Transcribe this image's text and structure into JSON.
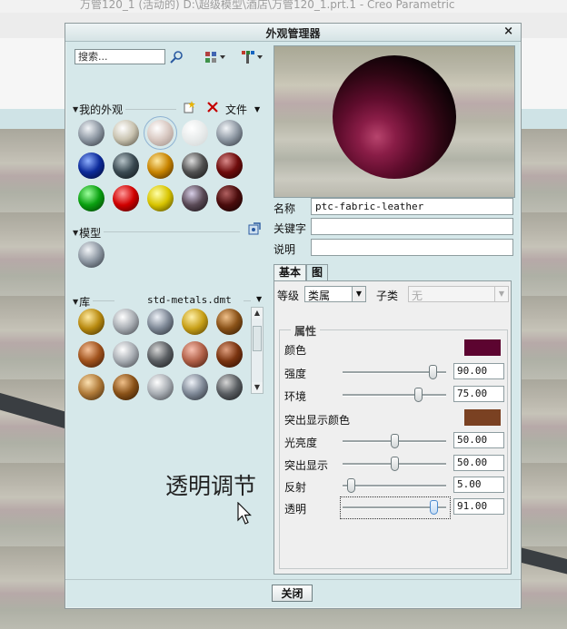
{
  "background": {
    "title_text": "万管120_1 (活动的) D:\\超级模型\\酒店\\万管120_1.prt.1 - Creo Parametric"
  },
  "dialog": {
    "title": "外观管理器",
    "close_glyph": "×"
  },
  "left": {
    "search_placeholder": "搜索...",
    "my_appearances": {
      "label": "我的外观",
      "file_menu": "文件"
    },
    "model": {
      "label": "模型"
    },
    "library": {
      "label": "库",
      "file": "std-metals.dmt"
    }
  },
  "colors": {
    "accent": "#5a0a2a",
    "color_swatch": "#5c0430",
    "highlight_swatch": "#7a4122",
    "dialog_bg": "#d6e8ea"
  },
  "swatches": {
    "my": [
      "metal-gray",
      "metal-pearl",
      "metal-pale-selected",
      "glass-clear",
      "metal-gray",
      "blue",
      "slate-dark",
      "amber",
      "charcoal",
      "maroon",
      "green",
      "red",
      "yellow",
      "stone",
      "dark-maroon"
    ],
    "model": [
      "metal-gray"
    ],
    "library": [
      "brass",
      "silver",
      "steel",
      "gold",
      "bronze",
      "copper",
      "silver",
      "graphite",
      "rose",
      "copper-dark",
      "bronze-light",
      "bronze",
      "silver",
      "steel",
      "graphite"
    ]
  },
  "properties": {
    "name_label": "名称",
    "name_value": "ptc-fabric-leather",
    "keyword_label": "关键字",
    "keyword_value": "",
    "desc_label": "说明",
    "desc_value": ""
  },
  "tabs": [
    {
      "label": "基本"
    },
    {
      "label": "图"
    }
  ],
  "basic": {
    "class_label": "等级",
    "class_value": "类属",
    "subclass_label": "子类",
    "subclass_value": "无",
    "group_title": "属性",
    "rows": [
      {
        "label": "颜色"
      },
      {
        "label": "强度",
        "value": "90.00",
        "level": 90
      },
      {
        "label": "环境",
        "value": "75.00",
        "level": 75
      },
      {
        "label": "突出显示颜色"
      },
      {
        "label": "光亮度",
        "value": "50.00",
        "level": 50
      },
      {
        "label": "突出显示",
        "value": "50.00",
        "level": 50
      },
      {
        "label": "反射",
        "value": "5.00",
        "level": 5
      },
      {
        "label": "透明",
        "value": "91.00",
        "level": 91
      }
    ]
  },
  "annotation": "透明调节",
  "footer": {
    "close_button": "关闭"
  }
}
